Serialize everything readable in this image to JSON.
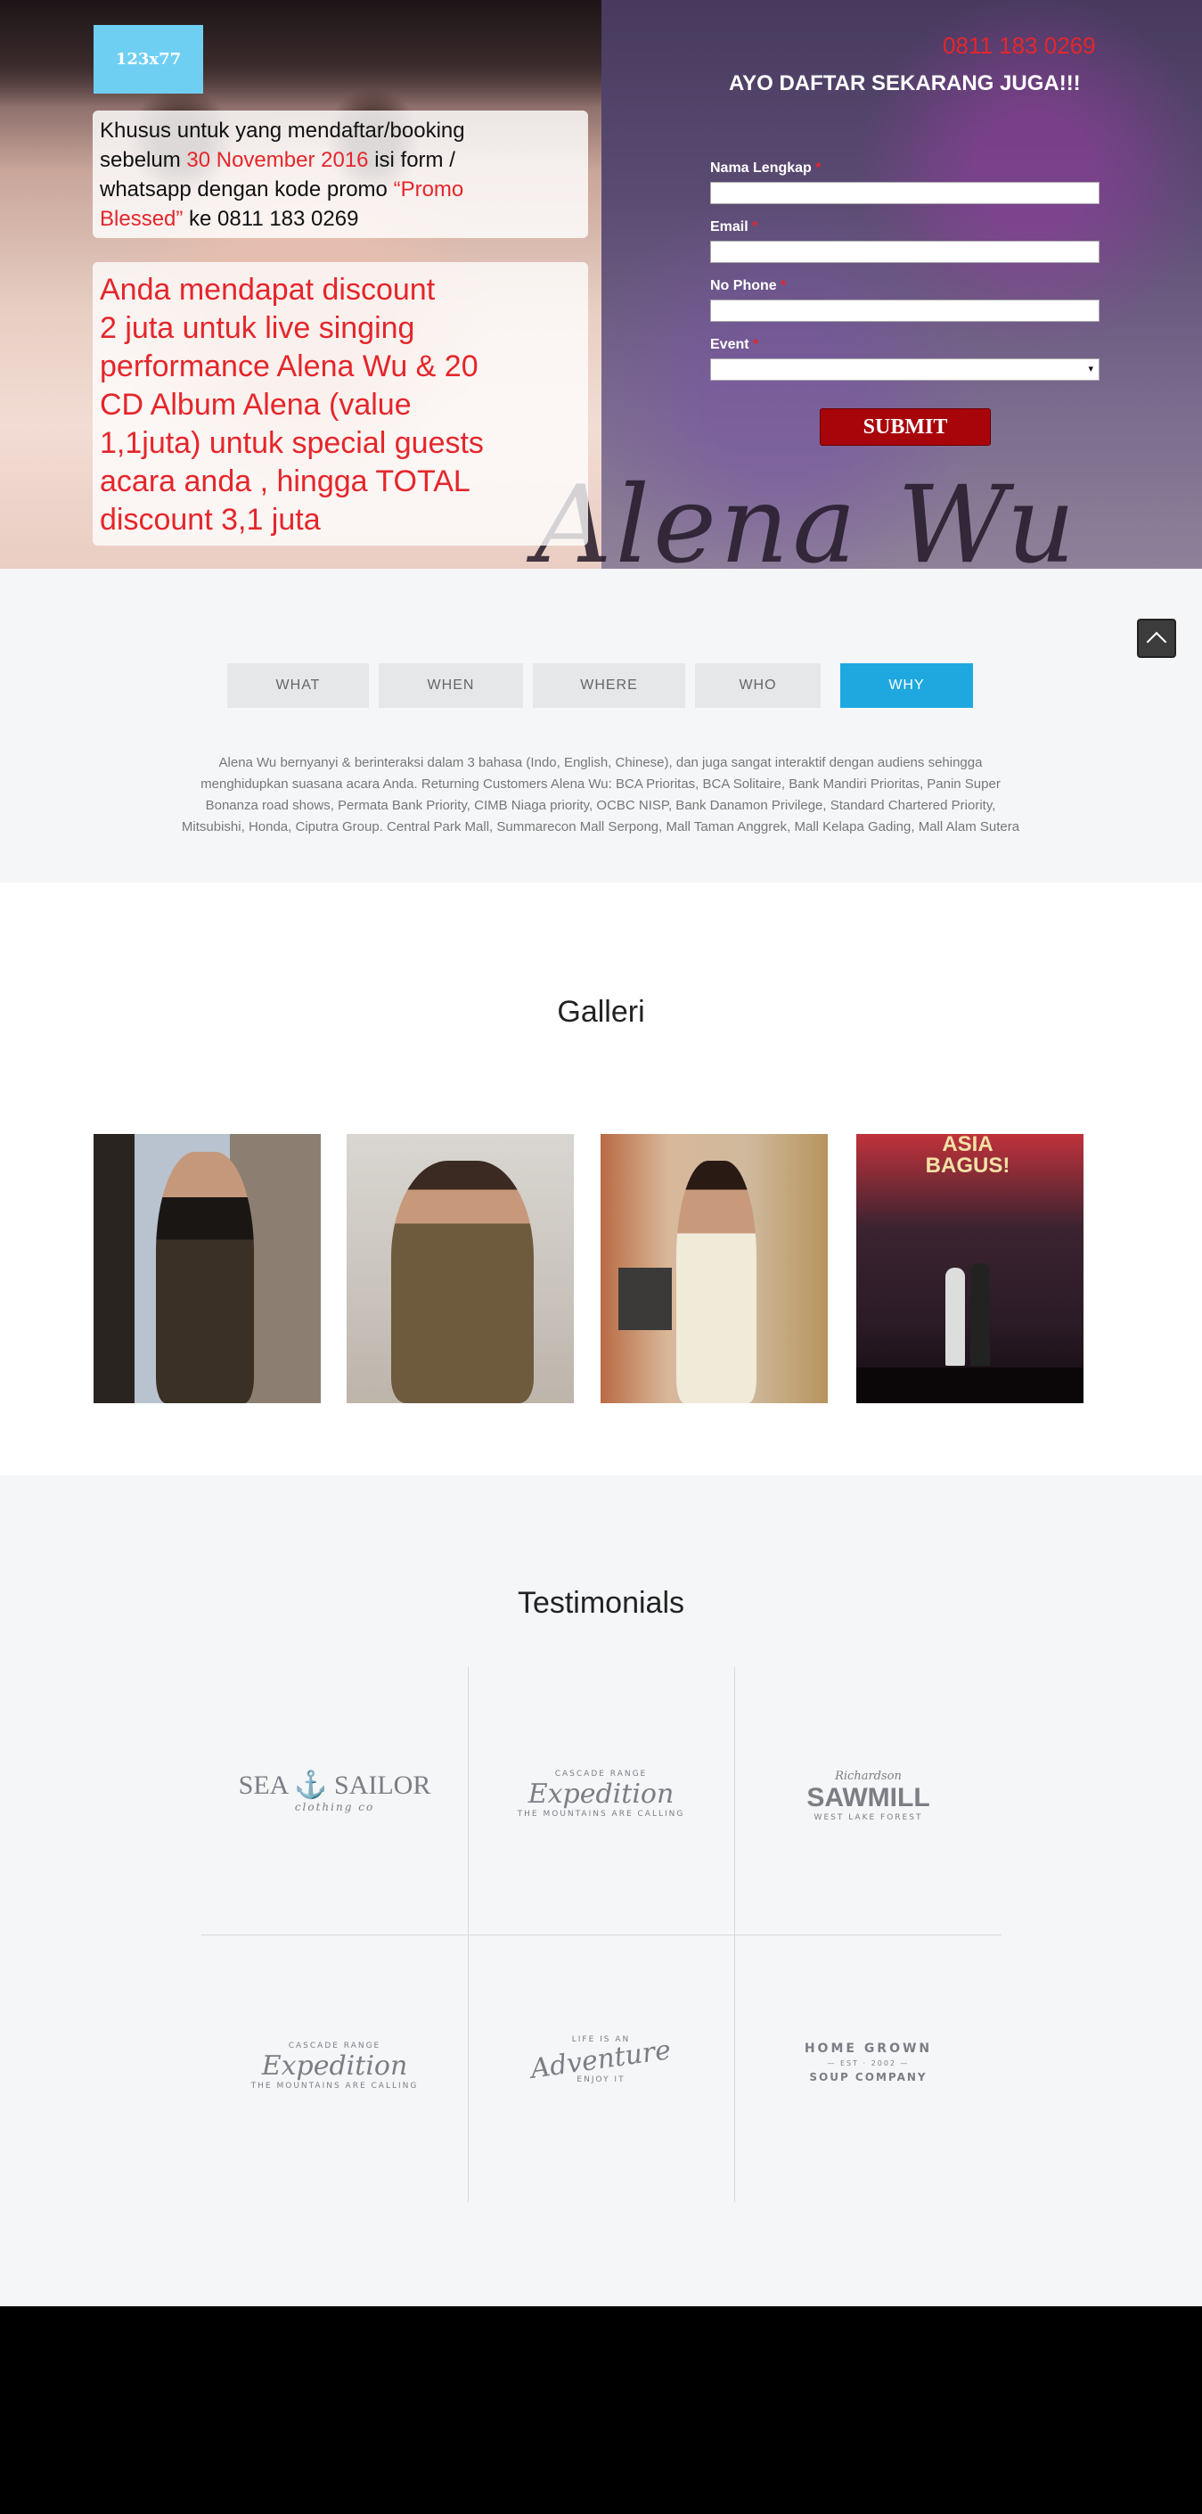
{
  "hero": {
    "logo_text": "123x77",
    "promo": {
      "line1": "Khusus untuk yang mendaftar/booking",
      "line2_a": "sebelum ",
      "line2_date": "30 November 2016",
      "line2_b": " isi form /",
      "line3": "whatsapp dengan kode promo ",
      "line3_code": "“Promo",
      "line4_code": "Blessed”",
      "line4_b": " ke 0811 183 0269"
    },
    "discount_lines": [
      "Anda mendapat discount",
      "2 juta untuk live singing",
      "performance Alena Wu & 20",
      "CD Album Alena (value",
      "1,1juta) untuk special guests",
      "acara anda , hingga TOTAL",
      "discount 3,1 juta"
    ],
    "signature": "Alena Wu"
  },
  "form": {
    "phone": "0811 183 0269",
    "title": "AYO DAFTAR SEKARANG JUGA!!!",
    "fields": [
      {
        "label": "Nama Lengkap",
        "required": "*"
      },
      {
        "label": "Email",
        "required": "*"
      },
      {
        "label": "No Phone",
        "required": "*"
      },
      {
        "label": "Event",
        "required": "*"
      }
    ],
    "select_arrow": "▾",
    "submit_label": "SUBMIT"
  },
  "tabs": {
    "items": [
      "WHAT",
      "WHEN",
      "WHERE",
      "WHO",
      "WHY"
    ],
    "active": "WHY",
    "content": "Alena Wu bernyanyi & berinteraksi dalam 3 bahasa (Indo, English, Chinese), dan juga sangat interaktif dengan audiens sehingga menghidupkan suasana acara Anda. Returning Customers Alena Wu: BCA Prioritas, BCA Solitaire, Bank Mandiri Prioritas, Panin Super Bonanza road shows, Permata Bank Priority, CIMB Niaga priority, OCBC NISP, Bank Danamon Privilege, Standard Chartered Priority, Mitsubishi, Honda, Ciputra Group. Central Park Mall, Summarecon Mall Serpong, Mall Taman Anggrek, Mall Kelapa Gading, Mall Alam Sutera"
  },
  "gallery": {
    "title": "Galleri",
    "asia_sign": "ASIA BAGUS!"
  },
  "testimonials": {
    "title": "Testimonials",
    "brands": [
      {
        "main": "SEA ⚓ SAILOR",
        "sub": "clothing co"
      },
      {
        "main": "Expedition",
        "sub": "THE MOUNTAINS ARE CALLING",
        "top": "CASCADE RANGE"
      },
      {
        "main": "SAWMILL",
        "sub": "WEST LAKE FOREST",
        "top": "Richardson"
      },
      {
        "main": "Expedition",
        "sub": "THE MOUNTAINS ARE CALLING",
        "top": "CASCADE RANGE"
      },
      {
        "main": "Adventure",
        "sub": "ENJOY IT",
        "top": "LIFE IS AN"
      },
      {
        "main": "HOME GROWN",
        "sub": "SOUP COMPANY",
        "top": "— EST · 2002 —"
      }
    ]
  },
  "colors": {
    "accent_red": "#e5262b",
    "tab_active": "#1fa8e0",
    "submit_bg": "#a8050b",
    "logo_bg": "#6fcff3"
  }
}
